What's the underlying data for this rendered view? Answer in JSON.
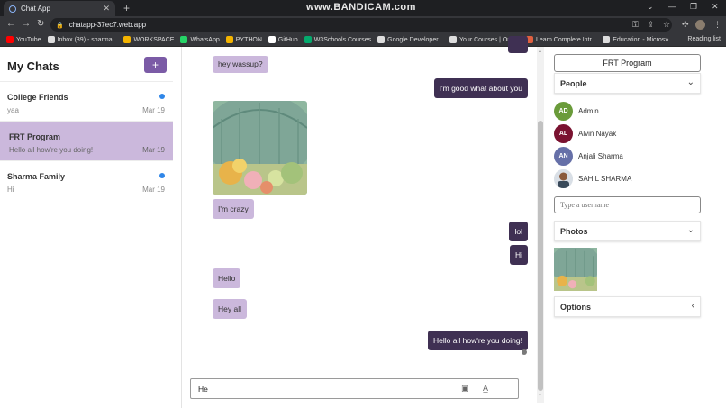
{
  "browser": {
    "tab_title": "Chat App",
    "new_tab": "+",
    "recorder_watermark": "www.BANDICAM.com",
    "url": "chatapp-37ec7.web.app",
    "bookmarks": [
      {
        "label": "YouTube",
        "color": "#ff0000"
      },
      {
        "label": "Inbox (39) - sharma...",
        "color": "#dddddd"
      },
      {
        "label": "WORKSPACE",
        "color": "#f4b400"
      },
      {
        "label": "WhatsApp",
        "color": "#25d366"
      },
      {
        "label": "PYTHON",
        "color": "#f4b400"
      },
      {
        "label": "GitHub",
        "color": "#ffffff"
      },
      {
        "label": "W3Schools Courses",
        "color": "#04aa6d"
      },
      {
        "label": "Google Developer...",
        "color": "#dddddd"
      },
      {
        "label": "Your Courses | One...",
        "color": "#dddddd"
      },
      {
        "label": "Learn Complete Intr...",
        "color": "#e06040"
      },
      {
        "label": "Education - Micros...",
        "color": "#dddddd"
      }
    ],
    "reading_list": "Reading list"
  },
  "sidebar": {
    "title": "My Chats",
    "new_chat_label": "+",
    "chats": [
      {
        "name": "College Friends",
        "preview": "yaa",
        "date": "Mar 19",
        "unread": true,
        "active": false
      },
      {
        "name": "FRT Program",
        "preview": "Hello all how're you doing!",
        "date": "Mar 19",
        "unread": false,
        "active": true
      },
      {
        "name": "Sharma Family",
        "preview": "Hi",
        "date": "Mar 19",
        "unread": true,
        "active": false
      }
    ]
  },
  "messages": [
    {
      "text": "hey wassup?",
      "dir": "in"
    },
    {
      "text": "I'm good what about you",
      "dir": "out"
    },
    {
      "type": "image",
      "dir": "in"
    },
    {
      "text": "I'm crazy",
      "dir": "in"
    },
    {
      "text": "lol",
      "dir": "out"
    },
    {
      "text": "Hi",
      "dir": "out"
    },
    {
      "text": "Hello",
      "dir": "in"
    },
    {
      "text": "Hey all",
      "dir": "in"
    },
    {
      "text": "Hello all how're you doing!",
      "dir": "out"
    }
  ],
  "composer": {
    "value": "He",
    "image_icon": "image-icon",
    "format_icon": "text-format-icon"
  },
  "details": {
    "group_name": "FRT Program",
    "people_label": "People",
    "people": [
      {
        "initials": "AD",
        "name": "Admin",
        "color": "#6a9b3a"
      },
      {
        "initials": "AL",
        "name": "Alvin Nayak",
        "color": "#7a1230"
      },
      {
        "initials": "AN",
        "name": "Anjali Sharma",
        "color": "#6670a8"
      },
      {
        "initials": "",
        "name": "SAHIL SHARMA",
        "color": "#3a4a5a"
      }
    ],
    "username_placeholder": "Type a username",
    "photos_label": "Photos",
    "options_label": "Options"
  },
  "colors": {
    "accent": "#7b5ba6",
    "incoming_bubble": "#cbb8dc",
    "outgoing_bubble": "#3f3053",
    "unread_dot": "#2f86e8"
  }
}
